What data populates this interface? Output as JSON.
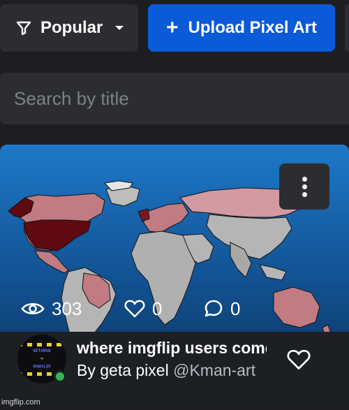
{
  "toolbar": {
    "filter_label": "Popular",
    "upload_label": "Upload Pixel Art"
  },
  "search": {
    "placeholder": "Search by title"
  },
  "card": {
    "views": "303",
    "likes": "0",
    "comments": "0",
    "title": "where imgflip users come from",
    "author_prefix": "By geta pixel",
    "author_handle": "@Kman-art",
    "avatar_text_top": "GETAMAN",
    "avatar_text_mid": "=",
    "avatar_text_bottom": "GETAMAN"
  },
  "watermark": "imgflip.com",
  "colors": {
    "accent": "#0b5ad8",
    "surface": "#2b2d31",
    "background": "#1c1e21",
    "online": "#34b551"
  }
}
